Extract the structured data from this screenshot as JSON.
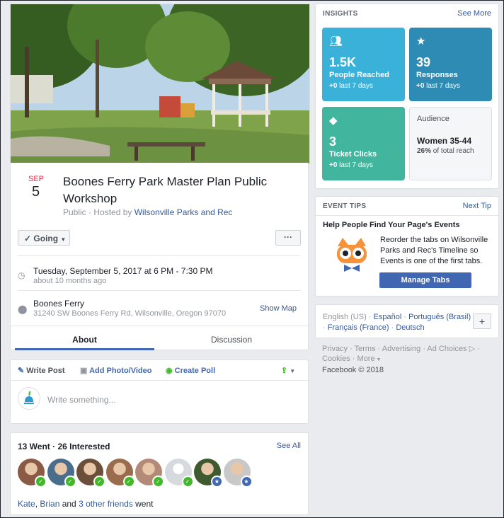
{
  "event": {
    "month": "SEP",
    "day": "5",
    "title": "Boones Ferry Park Master Plan Public Workshop",
    "privacy_prefix": "Public · Hosted by ",
    "host": "Wilsonville Parks and Rec",
    "going_label": "Going",
    "more_label": "···",
    "datetime": "Tuesday, September 5, 2017 at 6 PM - 7:30 PM",
    "relative_time": "about 10 months ago",
    "location_name": "Boones Ferry",
    "address": "31240 SW Boones Ferry Rd, Wilsonville, Oregon 97070",
    "show_map": "Show Map",
    "tabs": [
      {
        "label": "About",
        "active": true
      },
      {
        "label": "Discussion",
        "active": false
      }
    ]
  },
  "composer": {
    "write_post": "Write Post",
    "add_photo": "Add Photo/Video",
    "create_poll": "Create Poll",
    "placeholder": "Write something..."
  },
  "attendees": {
    "summary": "13 Went · 26 Interested",
    "see_all": "See All",
    "friend1": "Kate",
    "friend2": "Brian",
    "and_text": " and ",
    "others": "3 other friends",
    "went": " went",
    "faces": [
      {
        "name": "face-1",
        "color": "#8a5a44",
        "badge": "check"
      },
      {
        "name": "face-2",
        "color": "#4a6d8c",
        "badge": "check"
      },
      {
        "name": "face-3",
        "color": "#6b4f3a",
        "badge": "check"
      },
      {
        "name": "face-4",
        "color": "#9a6b4c",
        "badge": "check"
      },
      {
        "name": "face-5",
        "color": "#b38a78",
        "badge": "check"
      },
      {
        "name": "face-6",
        "color": "#d6d9de",
        "badge": "check"
      },
      {
        "name": "face-7",
        "color": "#3f5a2f",
        "badge": "star"
      },
      {
        "name": "face-8",
        "color": "#c8c8c8",
        "badge": "star"
      }
    ]
  },
  "insights": {
    "header": "INSIGHTS",
    "see_more": "See More",
    "reached_value": "1.5K",
    "reached_label": "People Reached",
    "responses_value": "39",
    "responses_label": "Responses",
    "clicks_value": "3",
    "clicks_label": "Ticket Clicks",
    "delta_bold": "+0",
    "delta_rest": " last 7 days",
    "audience_label": "Audience",
    "audience_value": "Women 35-44",
    "audience_pct": "26%",
    "audience_rest": " of total reach",
    "colors": {
      "reached": "#3ab1d9",
      "responses": "#2e8bb3",
      "clicks": "#42b59e"
    }
  },
  "tips": {
    "header": "EVENT TIPS",
    "next_tip": "Next Tip",
    "title": "Help People Find Your Page's Events",
    "body": "Reorder the tabs on Wilsonville Parks and Rec's Timeline so Events is one of the first tabs.",
    "button": "Manage Tabs"
  },
  "languages": {
    "current": "English (US)",
    "sep": " · ",
    "items": [
      "Español",
      "Português (Brasil)",
      "Français (France)",
      "Deutsch"
    ],
    "plus": "+"
  },
  "footer": {
    "links": [
      "Privacy",
      "Terms",
      "Advertising",
      "Ad Choices",
      "Cookies",
      "More"
    ],
    "copyright": "Facebook © 2018"
  }
}
